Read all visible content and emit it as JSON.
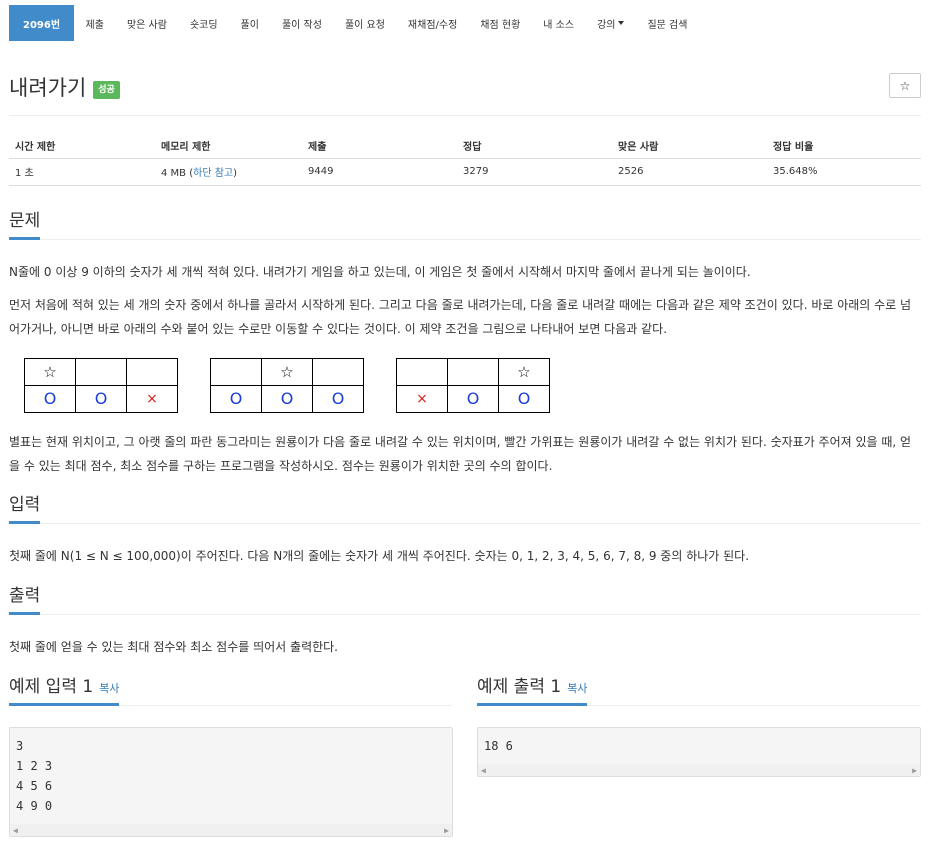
{
  "nav": {
    "tabs": [
      "2096번",
      "제출",
      "맞은 사람",
      "숏코딩",
      "풀이",
      "풀이 작성",
      "풀이 요청",
      "재채점/수정",
      "채점 현황",
      "내 소스",
      "강의",
      "질문 검색"
    ]
  },
  "problem": {
    "title": "내려가기",
    "badge": "성공",
    "star": "☆"
  },
  "info": {
    "headers": [
      "시간 제한",
      "메모리 제한",
      "제출",
      "정답",
      "맞은 사람",
      "정답 비율"
    ],
    "time": "1 초",
    "memory": "4 MB",
    "memory_note": "하단 참고",
    "submissions": "9449",
    "accepted": "3279",
    "solvers": "2526",
    "ratio": "35.648%"
  },
  "sections": {
    "problem": "문제",
    "input": "입력",
    "output": "출력",
    "sample_input": "예제 입력 1",
    "sample_output": "예제 출력 1",
    "copy": "복사"
  },
  "text": {
    "p1": "N줄에 0 이상 9 이하의 숫자가 세 개씩 적혀 있다. 내려가기 게임을 하고 있는데, 이 게임은 첫 줄에서 시작해서 마지막 줄에서 끝나게 되는 놀이이다.",
    "p2": "먼저 처음에 적혀 있는 세 개의 숫자 중에서 하나를 골라서 시작하게 된다. 그리고 다음 줄로 내려가는데, 다음 줄로 내려갈 때에는 다음과 같은 제약 조건이 있다. 바로 아래의 수로 넘어가거나, 아니면 바로 아래의 수와 붙어 있는 수로만 이동할 수 있다는 것이다. 이 제약 조건을 그림으로 나타내어 보면 다음과 같다.",
    "p3": "별표는 현재 위치이고, 그 아랫 줄의 파란 동그라미는 원룡이가 다음 줄로 내려갈 수 있는 위치이며, 빨간 가위표는 원룡이가 내려갈 수 없는 위치가 된다. 숫자표가 주어져 있을 때, 얻을 수 있는 최대 점수, 최소 점수를 구하는 프로그램을 작성하시오. 점수는 원룡이가 위치한 곳의 수의 합이다.",
    "input": "첫째 줄에 N(1 ≤ N ≤ 100,000)이 주어진다. 다음 N개의 줄에는 숫자가 세 개씩 주어진다. 숫자는 0, 1, 2, 3, 4, 5, 6, 7, 8, 9 중의 하나가 된다.",
    "output": "첫째 줄에 얻을 수 있는 최대 점수와 최소 점수를 띄어서 출력한다."
  },
  "figure": {
    "star": "☆",
    "circle": "O",
    "cross": "×"
  },
  "samples": {
    "input": "3\n1 2 3\n4 5 6\n4 9 0",
    "output": "18 6",
    "scroll_left": "◀",
    "scroll_right": "▶"
  }
}
